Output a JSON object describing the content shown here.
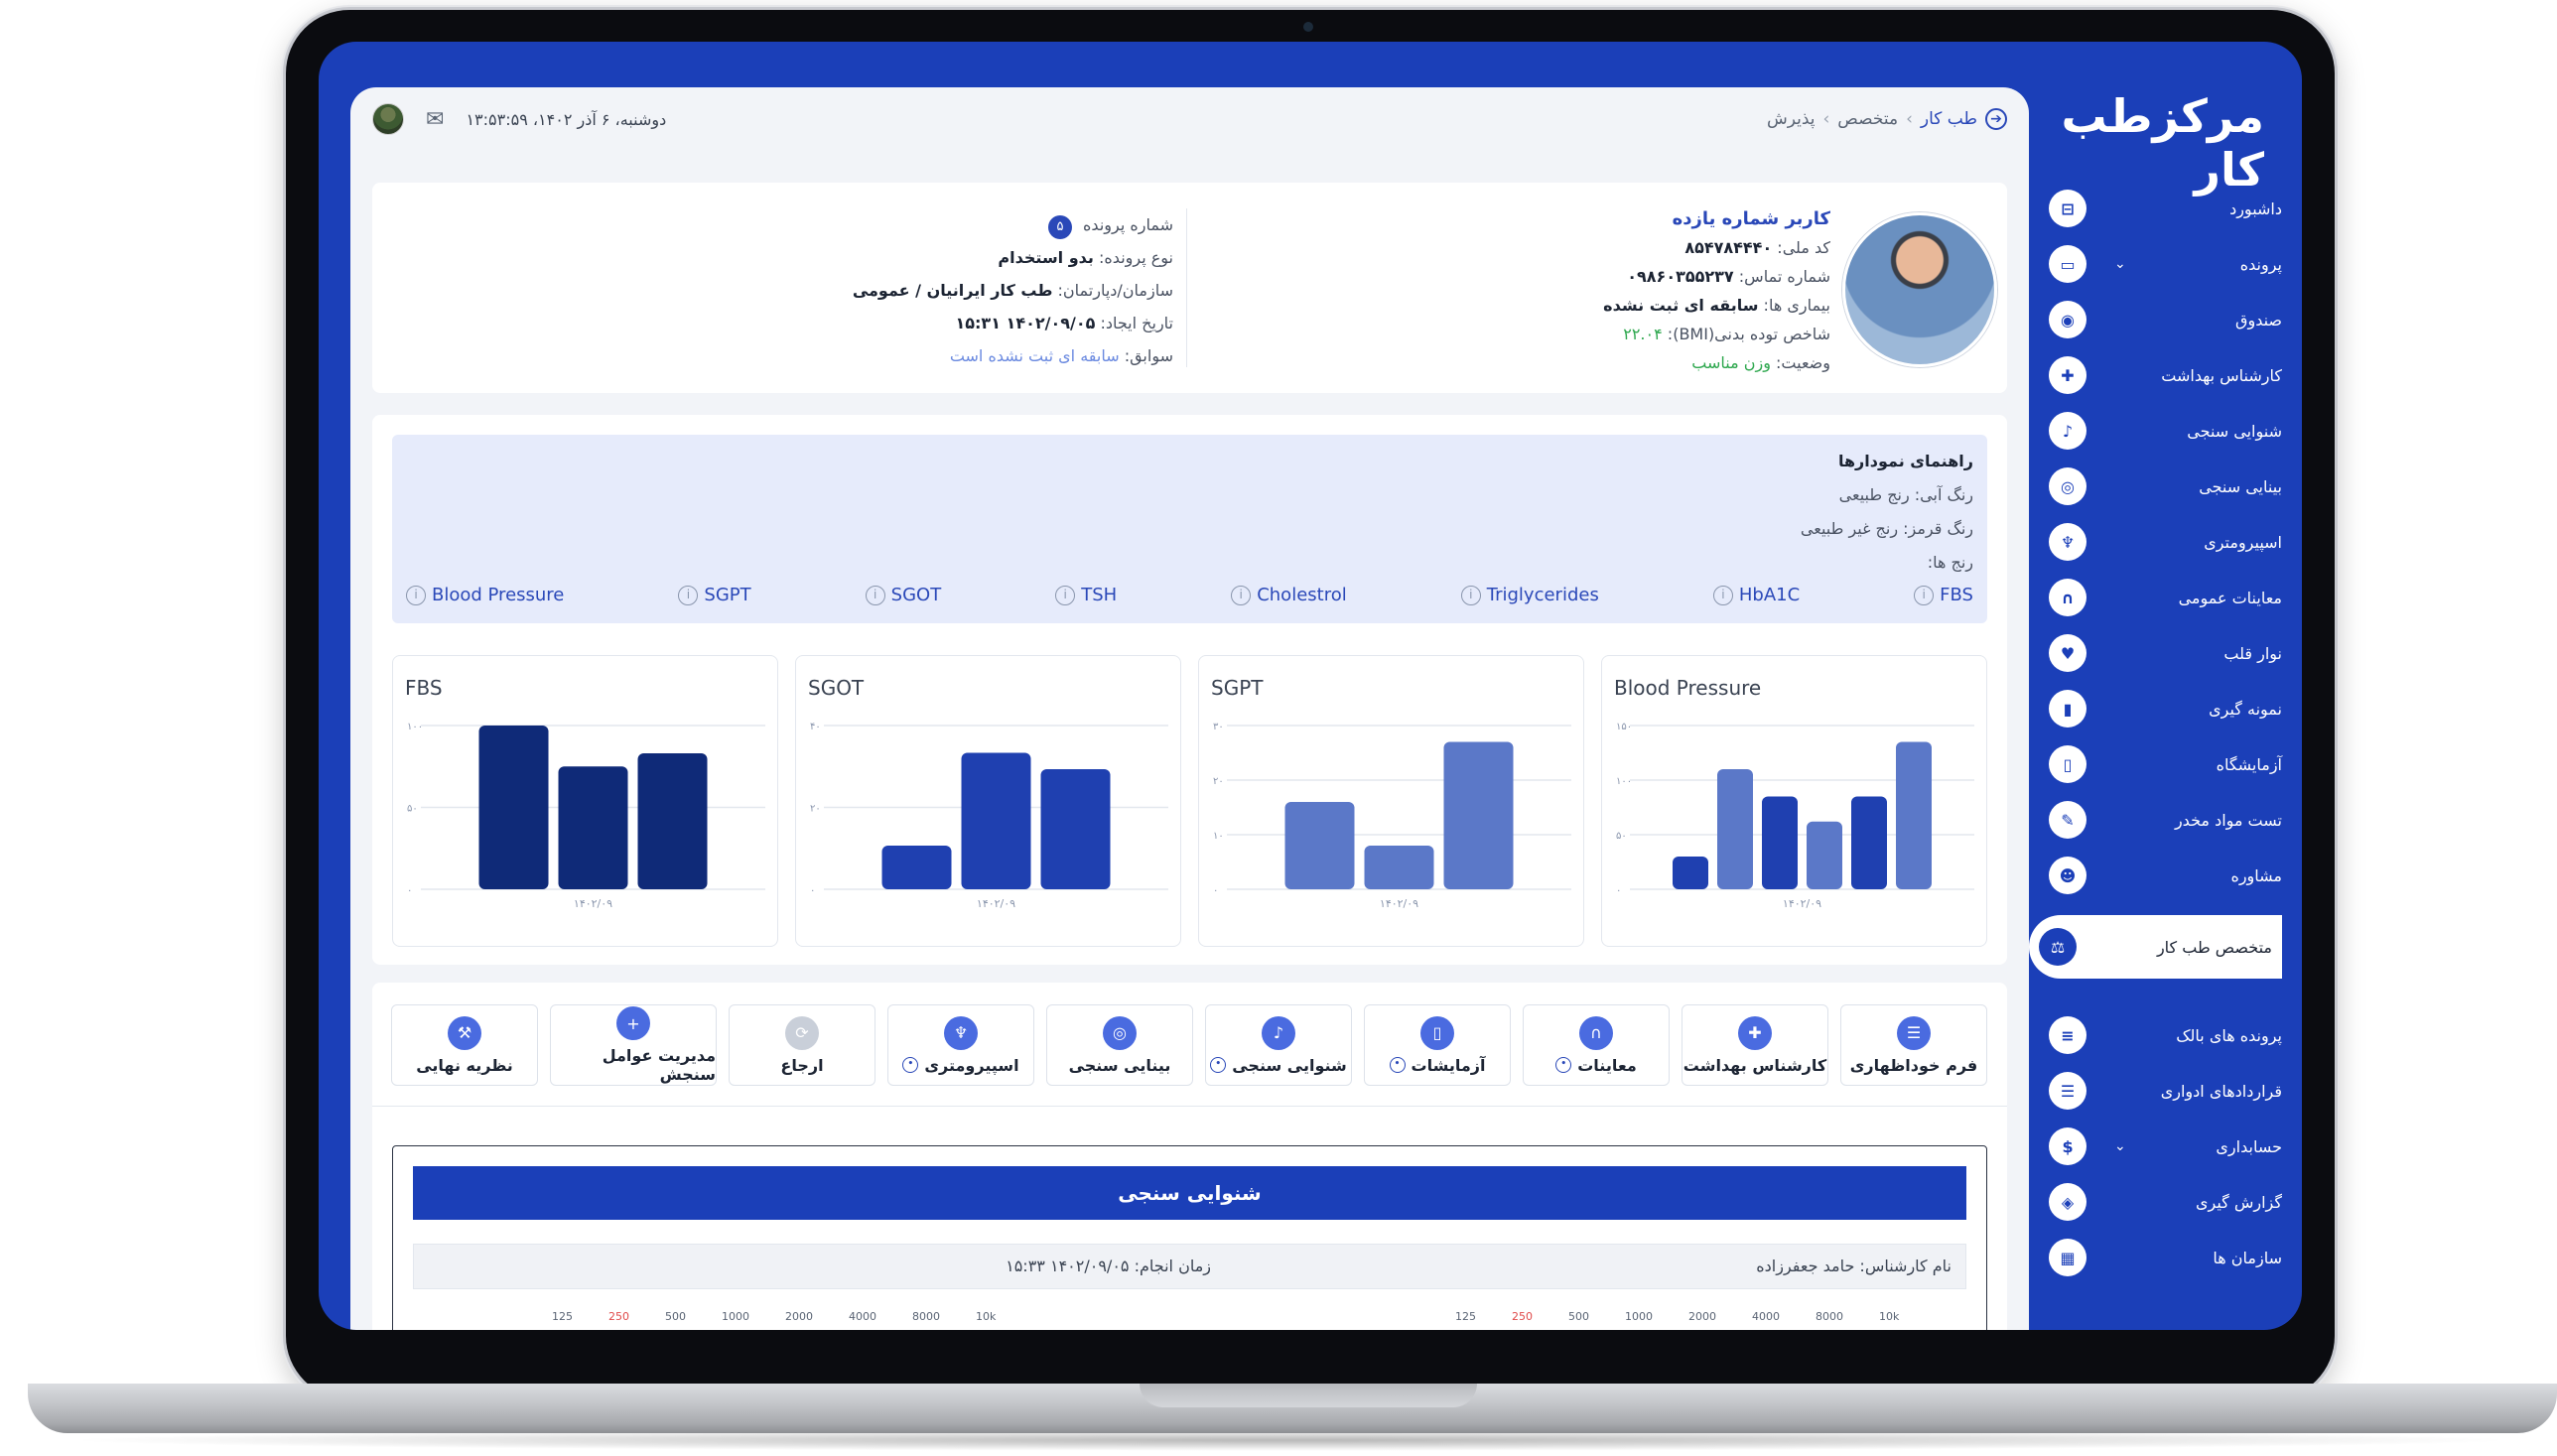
{
  "app": {
    "brand": "مرکزطب کار"
  },
  "breadcrumb": {
    "items": [
      "طب کار",
      "متخصص",
      "پذیرش"
    ]
  },
  "topbar": {
    "datetime": "دوشنبه، ۶ آذر ۱۴۰۲، ۱۳:۵۳:۵۹"
  },
  "profile": {
    "name": "کاربر شماره یازده",
    "national_code_label": "کد ملی:",
    "national_code": "۸۵۴۷۸۴۴۴۰",
    "phone_label": "شماره تماس:",
    "phone": "۰۹۸۶۰۳۵۵۲۳۷",
    "diseases_label": "بیماری ها:",
    "diseases": "سابقه ای ثبت نشده",
    "bmi_label": "شاخص توده بدنی(BMI):",
    "bmi": "۲۲.۰۴",
    "status_label": "وضعیت:",
    "status": "وزن مناسب"
  },
  "file": {
    "file_number_label": "شماره پرونده",
    "file_number": "۵",
    "file_type_label": "نوع پرونده:",
    "file_type": "بدو استخدام",
    "org_label": "سازمان/دپارتمان:",
    "org": "طب کار ایرانیان / عمومی",
    "created_label": "تاریخ ایجاد:",
    "created": "۱۴۰۲/۰۹/۰۵ ۱۵:۳۱",
    "history_label": "سوابق:",
    "history": "سابقه ای ثبت نشده است"
  },
  "guide": {
    "title": "راهنمای نمودارها",
    "blue_label": "رنگ آبی: رنج طبیعی",
    "red_label": "رنگ قرمز: رنج غیر طبیعی",
    "ranges_label": "رنج ها:",
    "legend": [
      "FBS",
      "HbA1C",
      "Triglycerides",
      "Cholestrol",
      "TSH",
      "SGOT",
      "SGPT",
      "Blood Pressure"
    ]
  },
  "chart_data": [
    {
      "type": "bar",
      "title": "FBS",
      "categories": [
        "۱۴۰۲/۰۹"
      ],
      "values": [
        100,
        75,
        83
      ],
      "ylim": [
        0,
        100
      ],
      "yticks": [
        "۰",
        "۵۰",
        "۱۰۰"
      ],
      "colors": [
        "#0f2a78",
        "#0f2a78",
        "#0f2a78"
      ]
    },
    {
      "type": "bar",
      "title": "SGOT",
      "categories": [
        "۱۴۰۲/۰۹"
      ],
      "values": [
        8,
        25,
        22
      ],
      "ylim": [
        0,
        30
      ],
      "yticks": [
        "۰",
        "۲۰",
        "۴۰"
      ],
      "colors": [
        "#1f40b0",
        "#1f40b0",
        "#1f40b0"
      ]
    },
    {
      "type": "bar",
      "title": "SGPT",
      "categories": [
        "۱۴۰۲/۰۹"
      ],
      "values": [
        16,
        8,
        27
      ],
      "ylim": [
        0,
        30
      ],
      "yticks": [
        "۰",
        "۱۰",
        "۲۰",
        "۳۰"
      ],
      "colors": [
        "#5b78c8",
        "#5b78c8",
        "#5b78c8"
      ]
    },
    {
      "type": "bar",
      "title": "Blood Pressure",
      "categories": [
        "۱۴۰۲/۰۹"
      ],
      "values": [
        30,
        110,
        85,
        62,
        85,
        135
      ],
      "ylim": [
        0,
        150
      ],
      "yticks": [
        "۰",
        "۵۰",
        "۱۰۰",
        "۱۵۰"
      ],
      "colors": [
        "#1f40b0",
        "#5b78c8",
        "#1f40b0",
        "#5b78c8",
        "#1f40b0",
        "#5b78c8"
      ]
    }
  ],
  "actions": [
    {
      "label": "فرم خوداظهاری",
      "icon": "form-icon",
      "dot": false,
      "disabled": false
    },
    {
      "label": "کارشناس بهداشت",
      "icon": "shield-icon",
      "dot": false,
      "disabled": false
    },
    {
      "label": "معاینات",
      "icon": "stethoscope-icon",
      "dot": true,
      "disabled": false
    },
    {
      "label": "آزمایشات",
      "icon": "test-tube-icon",
      "dot": true,
      "disabled": false
    },
    {
      "label": "شنوایی سنجی",
      "icon": "ear-icon",
      "dot": true,
      "disabled": false
    },
    {
      "label": "بینایی سنجی",
      "icon": "eye-icon",
      "dot": false,
      "disabled": false
    },
    {
      "label": "اسپیرومتری",
      "icon": "lungs-icon",
      "dot": true,
      "disabled": false
    },
    {
      "label": "ارجاع",
      "icon": "refresh-icon",
      "dot": false,
      "disabled": true
    },
    {
      "label": "مدیریت عوامل سنجش",
      "icon": "plus-icon",
      "dot": false,
      "disabled": false
    },
    {
      "label": "نظریه نهایی",
      "icon": "gavel-icon",
      "dot": false,
      "disabled": false
    }
  ],
  "report": {
    "title": "شنوایی سنجی",
    "expert_label": "نام کارشناس:",
    "expert": "حامد جعفرزاده",
    "time_label": "زمان انجام:",
    "time": "۱۴۰۲/۰۹/۰۵ ۱۵:۳۳",
    "freqs": [
      "125",
      "250",
      "500",
      "1000",
      "2000",
      "4000",
      "8000",
      "10k"
    ]
  },
  "sidebar": {
    "items": [
      {
        "label": "داشبورد",
        "icon": "inbox-icon"
      },
      {
        "label": "پرونده",
        "icon": "folder-icon",
        "chevron": true
      },
      {
        "label": "صندوق",
        "icon": "cash-box-icon"
      },
      {
        "label": "کارشناس بهداشت",
        "icon": "shield-plus-icon"
      },
      {
        "label": "شنوایی سنجی",
        "icon": "ear-icon"
      },
      {
        "label": "بینایی سنجی",
        "icon": "eye-icon"
      },
      {
        "label": "اسپیرومتری",
        "icon": "lungs-icon"
      },
      {
        "label": "معاینات عمومی",
        "icon": "stethoscope-icon"
      },
      {
        "label": "نوار قلب",
        "icon": "heart-icon"
      },
      {
        "label": "نمونه گیری",
        "icon": "vial-icon"
      },
      {
        "label": "آزمایشگاه",
        "icon": "test-tube-icon"
      },
      {
        "label": "تست مواد مخدر",
        "icon": "syringe-icon"
      },
      {
        "label": "مشاوره",
        "icon": "user-headset-icon"
      }
    ],
    "active": {
      "label": "متخصص طب کار",
      "icon": "gavel-icon"
    },
    "items2": [
      {
        "label": "پرونده های بالک",
        "icon": "database-icon"
      },
      {
        "label": "قراردادهای ادواری",
        "icon": "contract-icon"
      },
      {
        "label": "حسابداری",
        "icon": "dollar-icon",
        "chevron": true
      },
      {
        "label": "گزارش گیری",
        "icon": "layers-icon"
      },
      {
        "label": "سازمان ها",
        "icon": "building-icon"
      }
    ]
  }
}
